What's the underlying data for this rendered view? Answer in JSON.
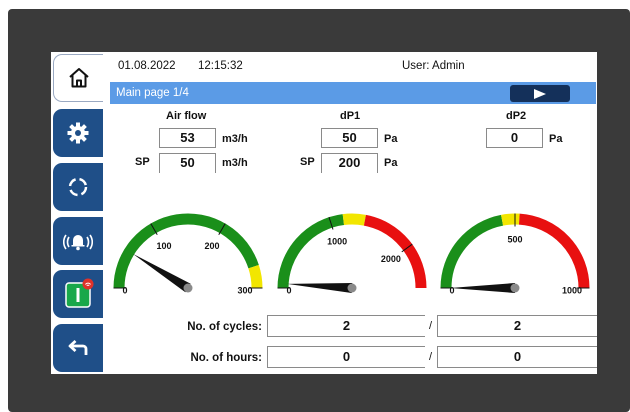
{
  "header": {
    "date": "01.08.2022",
    "time": "12:15:32",
    "user": "User: Admin"
  },
  "page_title": "Main page 1/4",
  "sidebar": {
    "items": [
      {
        "name": "home",
        "icon": "home-icon"
      },
      {
        "name": "settings",
        "icon": "gear-icon"
      },
      {
        "name": "refresh",
        "icon": "refresh-icon"
      },
      {
        "name": "alarm",
        "icon": "alarm-bell-icon"
      },
      {
        "name": "start",
        "icon": "power-switch-icon"
      },
      {
        "name": "back",
        "icon": "back-arrow-icon"
      }
    ]
  },
  "airflow": {
    "title": "Air flow",
    "value": "53",
    "unit": "m3/h",
    "sp_label": "SP",
    "sp_value": "50",
    "sp_unit": "m3/h"
  },
  "dp1": {
    "title": "dP1",
    "value": "50",
    "unit": "Pa",
    "sp_label": "SP",
    "sp_value": "200",
    "sp_unit": "Pa"
  },
  "dp2": {
    "title": "dP2",
    "value": "0",
    "unit": "Pa"
  },
  "gauges": [
    {
      "name": "airflow-gauge",
      "min": 0,
      "max": 300,
      "value": 53,
      "labels": [
        "0",
        "100",
        "200",
        "300"
      ],
      "bands": [
        {
          "from": 0,
          "to": 270,
          "color": "#1a8f1a"
        },
        {
          "from": 270,
          "to": 300,
          "color": "#f2e600"
        }
      ]
    },
    {
      "name": "dp1-gauge",
      "min": 0,
      "max": 2500,
      "value": 50,
      "labels": [
        "0",
        "1000",
        "2000"
      ],
      "bands": [
        {
          "from": 0,
          "to": 1150,
          "color": "#1a8f1a"
        },
        {
          "from": 1150,
          "to": 1400,
          "color": "#f2e600"
        },
        {
          "from": 1400,
          "to": 2500,
          "color": "#e81010"
        }
      ]
    },
    {
      "name": "dp2-gauge",
      "min": 0,
      "max": 1000,
      "value": 0,
      "labels": [
        "0",
        "500",
        "1000"
      ],
      "bands": [
        {
          "from": 0,
          "to": 440,
          "color": "#1a8f1a"
        },
        {
          "from": 440,
          "to": 520,
          "color": "#f2e600"
        },
        {
          "from": 520,
          "to": 1000,
          "color": "#e81010"
        }
      ]
    }
  ],
  "counters": {
    "cycles_label": "No. of cycles:",
    "cycles_a": "2",
    "cycles_b": "2",
    "hours_label": "No. of hours:",
    "hours_a": "0",
    "hours_b": "0",
    "separator": "/"
  },
  "colors": {
    "accent": "#5b9be6",
    "nav": "#1f4f88",
    "button": "#14305a"
  }
}
